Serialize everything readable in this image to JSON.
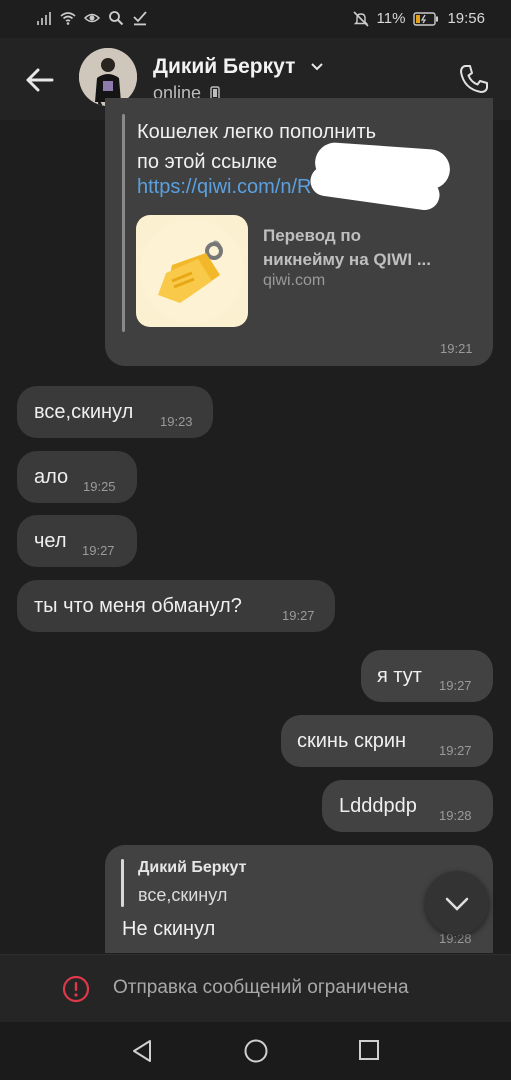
{
  "status_bar": {
    "battery": "11%",
    "time": "19:56"
  },
  "header": {
    "name": "Дикий Беркут",
    "status": "online"
  },
  "messages": {
    "link": {
      "text_line1": "Кошелек легко пополнить",
      "text_line2": "по этой ссылке",
      "url": "https://qiwi.com/n/R",
      "preview_title_1": "Перевод по",
      "preview_title_2": "никнейму на QIWI ...",
      "preview_domain": "qiwi.com",
      "time": "19:21"
    },
    "m1": {
      "text": "все,скинул",
      "time": "19:23"
    },
    "m2": {
      "text": "ало",
      "time": "19:25"
    },
    "m3": {
      "text": "чел",
      "time": "19:27"
    },
    "m4": {
      "text": "ты что меня обманул?",
      "time": "19:27"
    },
    "m5": {
      "text": "я тут",
      "time": "19:27"
    },
    "m6": {
      "text": "скинь скрин",
      "time": "19:27"
    },
    "m7": {
      "text": "Ldddpdp",
      "time": "19:28"
    },
    "m8": {
      "reply_author": "Дикий Беркут",
      "reply_text": "все,скинул",
      "text": "Не скинул",
      "time": "19:28"
    }
  },
  "footer": {
    "restriction_text": "Отправка сообщений ограничена"
  },
  "colors": {
    "background": "#1e1e1e",
    "bubble": "#3a3a3a",
    "link": "#5aa0e0",
    "warning": "#e0384b"
  }
}
